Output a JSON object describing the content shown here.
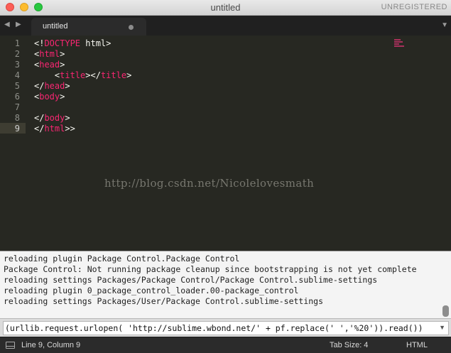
{
  "window": {
    "title": "untitled",
    "license": "UNREGISTERED"
  },
  "tabs": [
    {
      "label": "untitled"
    }
  ],
  "editor": {
    "line_numbers": [
      "1",
      "2",
      "3",
      "4",
      "5",
      "6",
      "7",
      "8",
      "9"
    ],
    "active_line": 9,
    "lines": [
      [
        [
          "punc",
          "<!"
        ],
        [
          "kw",
          "DOCTYPE"
        ],
        [
          "punc",
          " html>"
        ]
      ],
      [
        [
          "punc",
          "<"
        ],
        [
          "tag",
          "html"
        ],
        [
          "punc",
          ">"
        ]
      ],
      [
        [
          "punc",
          "<"
        ],
        [
          "tag",
          "head"
        ],
        [
          "punc",
          ">"
        ]
      ],
      [
        [
          "punc",
          "    <"
        ],
        [
          "tag",
          "title"
        ],
        [
          "punc",
          "></"
        ],
        [
          "tag",
          "title"
        ],
        [
          "punc",
          ">"
        ]
      ],
      [
        [
          "punc",
          "</"
        ],
        [
          "tag",
          "head"
        ],
        [
          "punc",
          ">"
        ]
      ],
      [
        [
          "punc",
          "<"
        ],
        [
          "tag",
          "body"
        ],
        [
          "punc",
          ">"
        ]
      ],
      [],
      [
        [
          "punc",
          "</"
        ],
        [
          "tag",
          "body"
        ],
        [
          "punc",
          ">"
        ]
      ],
      [
        [
          "punc",
          "</"
        ],
        [
          "tag",
          "html"
        ],
        [
          "punc",
          ">>"
        ]
      ]
    ],
    "watermark": "http://blog.csdn.net/Nicolelovesmath"
  },
  "console": {
    "lines": [
      "reloading plugin Package Control.Package Control",
      "Package Control: Not running package cleanup since bootstrapping is not yet complete",
      "reloading settings Packages/Package Control/Package Control.sublime-settings",
      "reloading plugin 0_package_control_loader.00-package_control",
      "reloading settings Packages/User/Package Control.sublime-settings"
    ]
  },
  "input": {
    "value": "(urllib.request.urlopen( 'http://sublime.wbond.net/' + pf.replace(' ','%20')).read())"
  },
  "status": {
    "position": "Line 9, Column 9",
    "tab_size": "Tab Size: 4",
    "syntax": "HTML"
  },
  "colors": {
    "tag": "#f92672",
    "editor_bg": "#272822"
  }
}
